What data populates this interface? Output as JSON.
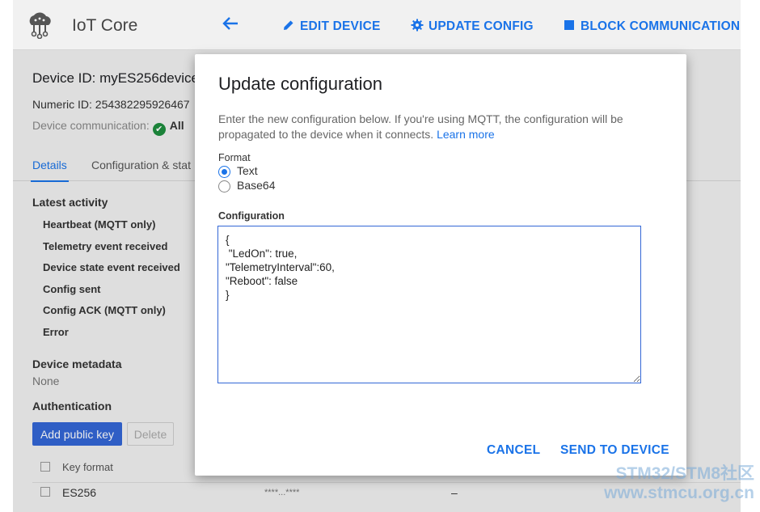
{
  "app": {
    "title": "IoT Core",
    "logo_icon": "iot-core-cloud-icon",
    "accent_color": "#1a73e8"
  },
  "toolbar": {
    "back_icon": "arrow-left-icon",
    "edit_label": "EDIT DEVICE",
    "update_config_label": "UPDATE CONFIG",
    "block_label": "BLOCK COMMUNICATION"
  },
  "device": {
    "id_text": "Device ID: myES256device",
    "numeric_id_text": "Numeric ID: 254382295926467",
    "communication_label": "Device communication:",
    "communication_value": "All"
  },
  "tabs": [
    {
      "label": "Details",
      "active": true
    },
    {
      "label": "Configuration & stat",
      "active": false
    }
  ],
  "latest_activity": {
    "heading": "Latest activity",
    "rows": [
      "Heartbeat (MQTT only)",
      "Telemetry event received",
      "Device state event received",
      "Config sent",
      "Config ACK (MQTT only)",
      "Error"
    ]
  },
  "metadata": {
    "heading": "Device metadata",
    "value": "None"
  },
  "authentication": {
    "heading": "Authentication",
    "add_button": "Add public key",
    "delete_button": "Delete",
    "column_key_format": "Key format",
    "rows": [
      {
        "key_format": "ES256",
        "key_value": "****...****",
        "extra": "–"
      }
    ]
  },
  "dialog": {
    "title": "Update configuration",
    "description": "Enter the new configuration below. If you're using MQTT, the configuration will be propagated to the device when it connects.",
    "learn_more": "Learn more",
    "format_label": "Format",
    "format_options": [
      {
        "label": "Text",
        "selected": true
      },
      {
        "label": "Base64",
        "selected": false
      }
    ],
    "config_label": "Configuration",
    "config_value": "{\n \"LedOn\": true,\n\"TelemetryInterval\":60,\n\"Reboot\": false\n}",
    "cancel_label": "CANCEL",
    "send_label": "SEND TO DEVICE"
  },
  "watermark": {
    "line1": "STM32/STM8社区",
    "line2": "www.stmcu.org.cn"
  }
}
